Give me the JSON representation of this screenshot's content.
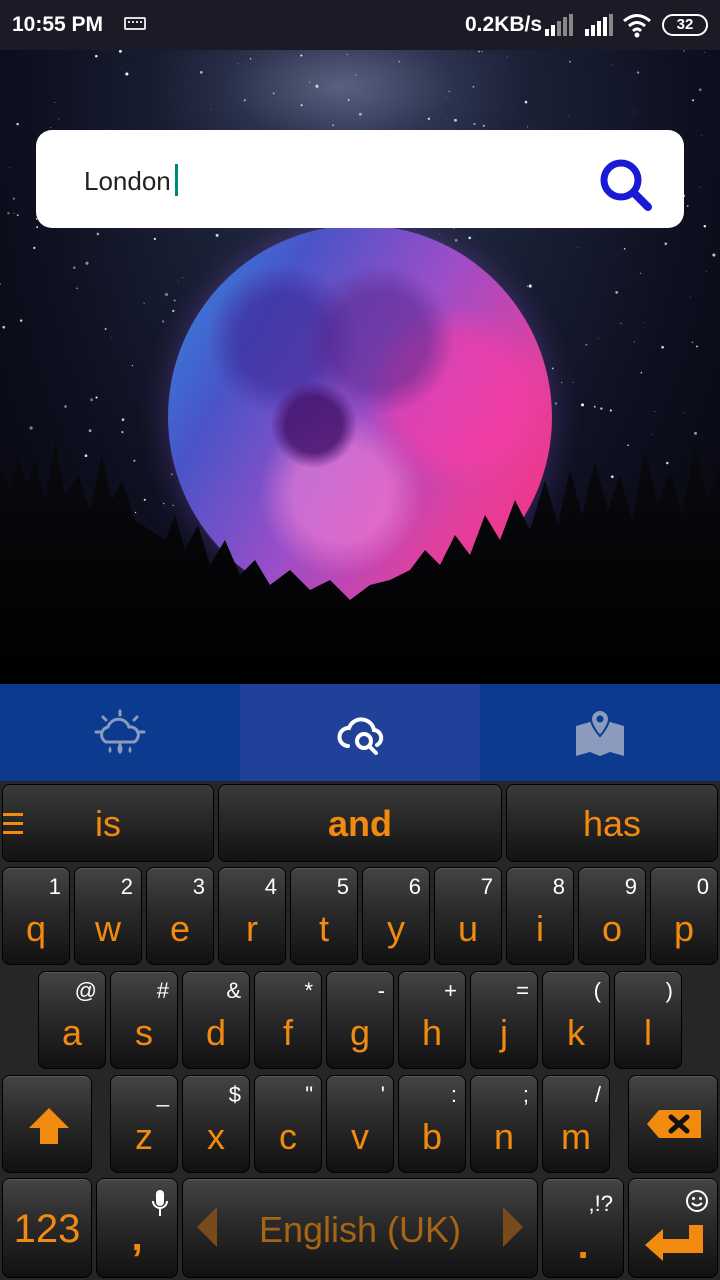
{
  "status_bar": {
    "time": "10:55 PM",
    "network_speed": "0.2KB/s",
    "battery": "32"
  },
  "search": {
    "value": "London"
  },
  "nav": {
    "tabs": [
      {
        "icon": "weather-cloud-icon"
      },
      {
        "icon": "cloud-search-icon",
        "active": true
      },
      {
        "icon": "map-pin-icon"
      }
    ]
  },
  "keyboard": {
    "suggestions": [
      "is",
      "and",
      "has"
    ],
    "row1": [
      {
        "main": "q",
        "alt": "1"
      },
      {
        "main": "w",
        "alt": "2"
      },
      {
        "main": "e",
        "alt": "3"
      },
      {
        "main": "r",
        "alt": "4"
      },
      {
        "main": "t",
        "alt": "5"
      },
      {
        "main": "y",
        "alt": "6"
      },
      {
        "main": "u",
        "alt": "7"
      },
      {
        "main": "i",
        "alt": "8"
      },
      {
        "main": "o",
        "alt": "9"
      },
      {
        "main": "p",
        "alt": "0"
      }
    ],
    "row2": [
      {
        "main": "a",
        "alt": "@"
      },
      {
        "main": "s",
        "alt": "#"
      },
      {
        "main": "d",
        "alt": "&"
      },
      {
        "main": "f",
        "alt": "*"
      },
      {
        "main": "g",
        "alt": "-"
      },
      {
        "main": "h",
        "alt": "+"
      },
      {
        "main": "j",
        "alt": "="
      },
      {
        "main": "k",
        "alt": "("
      },
      {
        "main": "l",
        "alt": ")"
      }
    ],
    "row3": [
      {
        "main": "z",
        "alt": "_"
      },
      {
        "main": "x",
        "alt": "$"
      },
      {
        "main": "c",
        "alt": "\""
      },
      {
        "main": "v",
        "alt": "'"
      },
      {
        "main": "b",
        "alt": ":"
      },
      {
        "main": "n",
        "alt": ";"
      },
      {
        "main": "m",
        "alt": "/"
      }
    ],
    "symbols_label": "123",
    "comma": ",",
    "space_label": "English (UK)",
    "period": ".",
    "period_alt": ",!?",
    "accent_color": "#f28a10"
  }
}
